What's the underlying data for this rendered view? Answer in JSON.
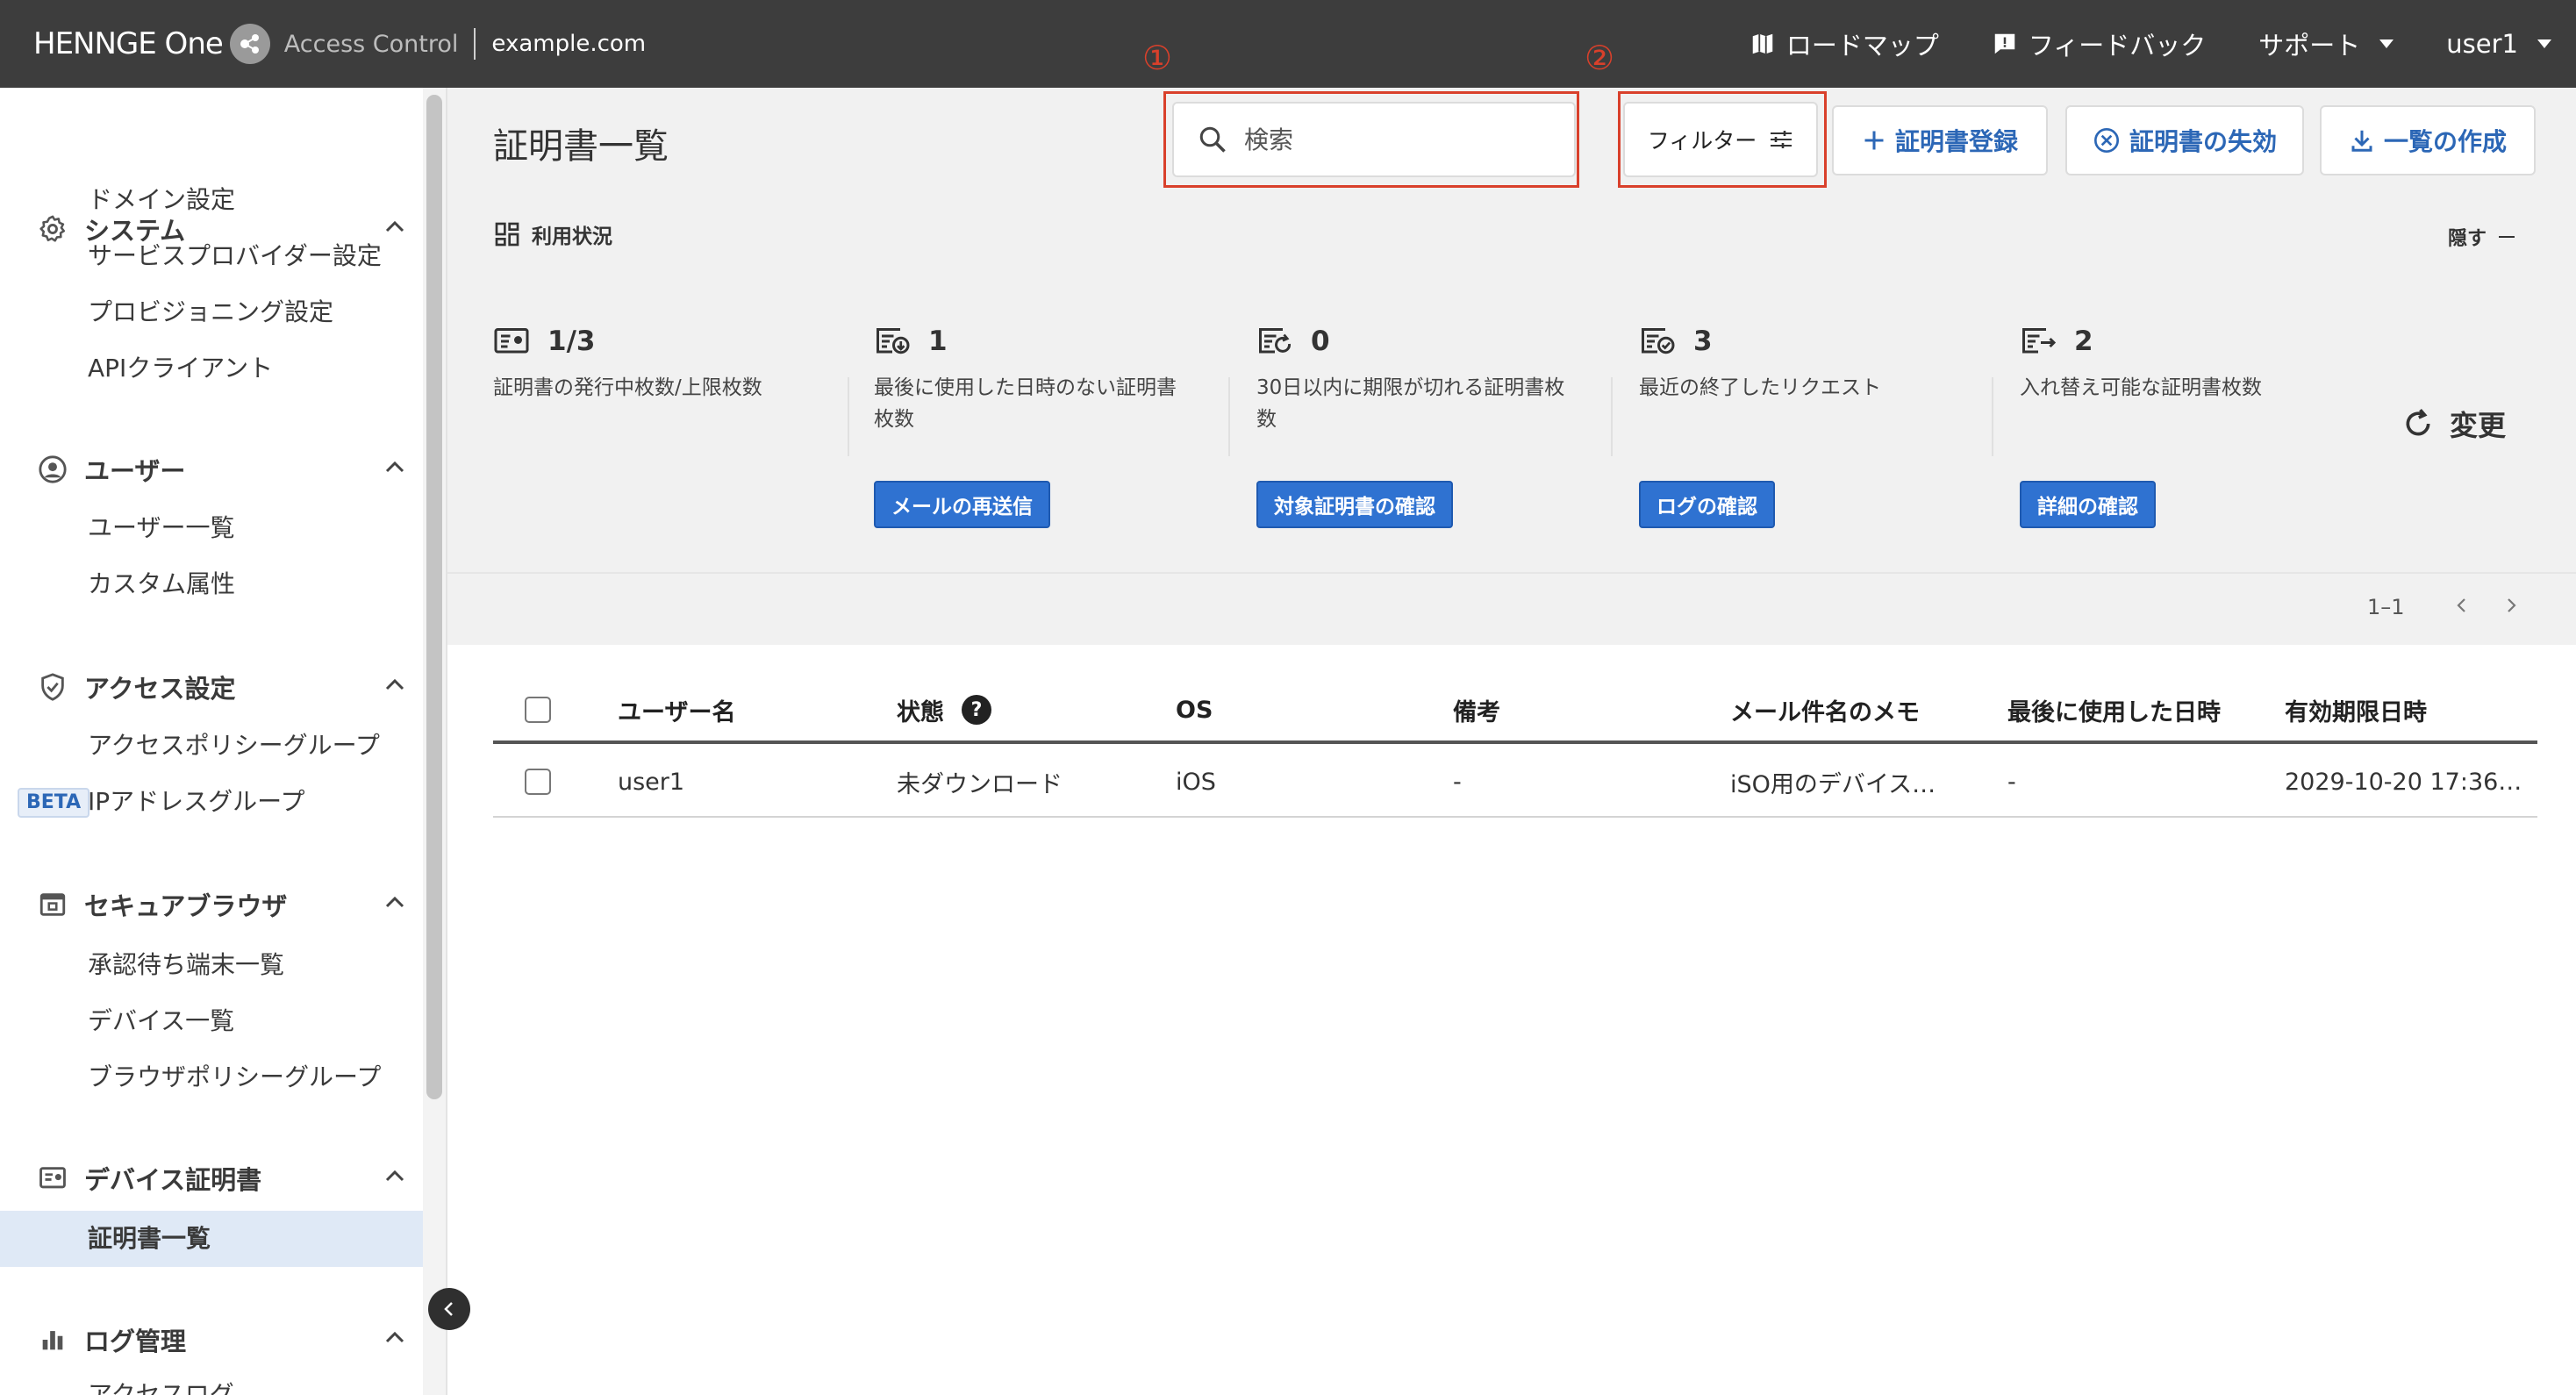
{
  "header": {
    "brand": "HENNGE One",
    "product": "Access Control",
    "domain": "example.com",
    "nav": {
      "roadmap": "ロードマップ",
      "feedback": "フィードバック",
      "support": "サポート",
      "user": "user1"
    }
  },
  "sidebar": {
    "sections": [
      {
        "title": "システム",
        "icon": "gear-icon",
        "items": [
          "ドメイン設定",
          "サービスプロバイダー設定",
          "プロビジョニング設定",
          "APIクライアント"
        ]
      },
      {
        "title": "ユーザー",
        "icon": "user-circle-icon",
        "items": [
          "ユーザー一覧",
          "カスタム属性"
        ]
      },
      {
        "title": "アクセス設定",
        "icon": "shield-icon",
        "items": [
          "アクセスポリシーグループ",
          "IPアドレスグループ"
        ],
        "beta": "BETA"
      },
      {
        "title": "セキュアブラウザ",
        "icon": "browser-icon",
        "items": [
          "承認待ち端末一覧",
          "デバイス一覧",
          "ブラウザポリシーグループ"
        ]
      },
      {
        "title": "デバイス証明書",
        "icon": "certificate-icon",
        "items": [
          "証明書一覧"
        ]
      },
      {
        "title": "ログ管理",
        "icon": "bar-chart-icon",
        "items": [
          "アクセスログ"
        ]
      }
    ]
  },
  "main": {
    "title": "証明書一覧",
    "search_placeholder": "検索",
    "filter_label": "フィルター",
    "annotation_1": "①",
    "annotation_2": "②",
    "buttons": {
      "register": "証明書登録",
      "revoke": "証明書の失効",
      "export": "一覧の作成"
    },
    "usage": {
      "title": "利用状況",
      "hide": "隠す",
      "change": "変更",
      "stats": [
        {
          "value": "1/3",
          "desc": "証明書の発行中枚数/上限枚数",
          "button": ""
        },
        {
          "value": "1",
          "desc": "最後に使用した日時のない証明書枚数",
          "button": "メールの再送信"
        },
        {
          "value": "0",
          "desc": "30日以内に期限が切れる証明書枚数",
          "button": "対象証明書の確認"
        },
        {
          "value": "3",
          "desc": "最近の終了したリクエスト",
          "button": "ログの確認"
        },
        {
          "value": "2",
          "desc": "入れ替え可能な証明書枚数",
          "button": "詳細の確認"
        }
      ]
    },
    "pagination": "1–1",
    "table": {
      "columns": [
        "ユーザー名",
        "状態",
        "OS",
        "備考",
        "メール件名のメモ",
        "最後に使用した日時",
        "有効期限日時"
      ],
      "rows": [
        [
          "user1",
          "未ダウンロード",
          "iOS",
          "-",
          "iSO用のデバイス…",
          "-",
          "2029-10-20 17:36…"
        ]
      ]
    }
  }
}
